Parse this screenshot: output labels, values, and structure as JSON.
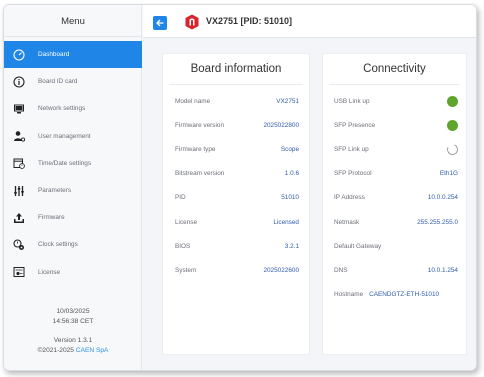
{
  "sidebar": {
    "menu_title": "Menu",
    "items": [
      {
        "label": "Dashboard",
        "icon": "dashboard-icon",
        "active": true
      },
      {
        "label": "Board ID card",
        "icon": "info-icon"
      },
      {
        "label": "Network settings",
        "icon": "monitor-icon"
      },
      {
        "label": "User management",
        "icon": "user-gear-icon"
      },
      {
        "label": "Time/Date settings",
        "icon": "calendar-clock-icon"
      },
      {
        "label": "Parameters",
        "icon": "sliders-icon"
      },
      {
        "label": "Firmware",
        "icon": "upload-tray-icon"
      },
      {
        "label": "Clock settings",
        "icon": "clock-settings-icon"
      },
      {
        "label": "License",
        "icon": "license-icon"
      }
    ],
    "footer": {
      "date": "10/03/2025",
      "time": "14:56:38 CET",
      "version": "Version 1.3.1",
      "copyright_prefix": "©2021-2025 ",
      "brand": "CAEN SpA"
    }
  },
  "header": {
    "title": "VX2751 [PID: 51010]",
    "accent": "#1f86e8",
    "logo_color": "#d8232a"
  },
  "board_info": {
    "title": "Board information",
    "rows": [
      {
        "key": "Model name",
        "value": "VX2751"
      },
      {
        "key": "Firmware version",
        "value": "2025022800"
      },
      {
        "key": "Firmware type",
        "value": "Scope"
      },
      {
        "key": "Bitstream version",
        "value": "1.0.6"
      },
      {
        "key": "PID",
        "value": "51010"
      },
      {
        "key": "License",
        "value": "Licensed"
      },
      {
        "key": "BIOS",
        "value": "3.2.1"
      },
      {
        "key": "System",
        "value": "2025022600"
      }
    ]
  },
  "connectivity": {
    "title": "Connectivity",
    "status_on_color": "#5ea530",
    "rows": [
      {
        "key": "USB Link up",
        "status": "on"
      },
      {
        "key": "SFP Presence",
        "status": "on"
      },
      {
        "key": "SFP Link up",
        "status": "off"
      },
      {
        "key": "SFP Protocol",
        "value": "Eth1G"
      },
      {
        "key": "IP Address",
        "value": "10.0.0.254"
      },
      {
        "key": "Netmask",
        "value": "255.255.255.0"
      },
      {
        "key": "Default Gateway",
        "value": ""
      },
      {
        "key": "DNS",
        "value": "10.0.1.254"
      },
      {
        "key": "Hostname",
        "value": "CAENDGTZ-ETH-51010"
      }
    ]
  }
}
